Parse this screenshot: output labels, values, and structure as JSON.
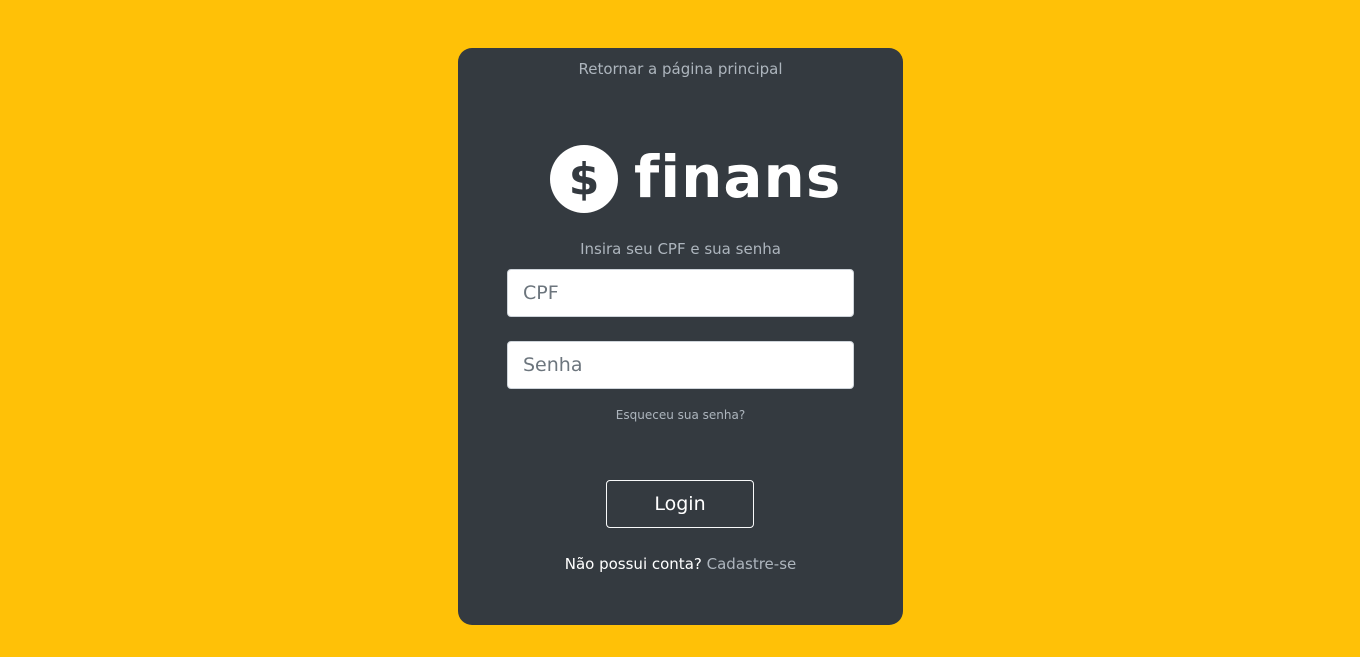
{
  "colors": {
    "background": "#FFC107",
    "card": "#343A40",
    "muted_text": "#ADB5BD",
    "white": "#FFFFFF"
  },
  "nav": {
    "back_label": "Retornar a página principal"
  },
  "brand": {
    "logo_icon": "dollar-circle-icon",
    "name": "finans"
  },
  "form": {
    "instruction": "Insira seu CPF e sua senha",
    "cpf_placeholder": "CPF",
    "password_placeholder": "Senha",
    "forgot_label": "Esqueceu sua senha?",
    "login_label": "Login",
    "signup_prompt": "Não possui conta?",
    "signup_link": "Cadastre-se"
  }
}
